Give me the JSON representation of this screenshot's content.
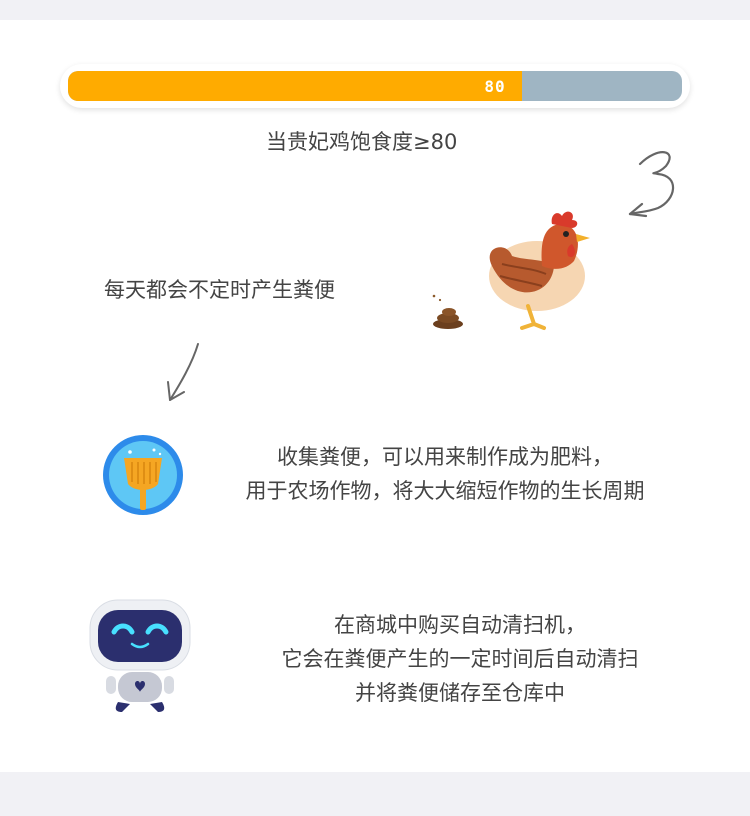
{
  "satiety": {
    "value_label": "80",
    "fill_percent": 74,
    "fill_color": "#ffab00",
    "track_color": "#9fb5c3"
  },
  "caption_threshold": "当贵妃鸡饱食度≥80",
  "caption_daily": "每天都会不定时产生粪便",
  "collect_info": {
    "line1": "收集粪便，可以用来制作成为肥料，",
    "line2": "用于农场作物，将大大缩短作物的生长周期"
  },
  "robot_info": {
    "line1": "在商城中购买自动清扫机，",
    "line2": "它会在粪便产生的一定时间后自动清扫",
    "line3": "并将粪便储存至仓库中"
  },
  "icons": {
    "chicken": "chicken-icon",
    "poop": "poop-icon",
    "shovel": "shovel-icon",
    "robot": "robot-icon"
  }
}
